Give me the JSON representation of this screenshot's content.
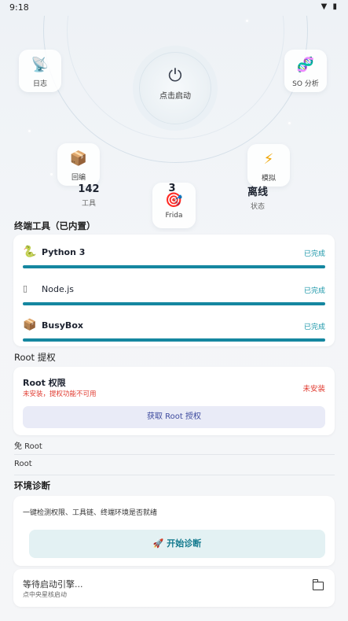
{
  "status_bar": {
    "time": "9:18",
    "icons": "▼ ▮"
  },
  "hero": {
    "power_label": "点击启动",
    "tiles": [
      {
        "icon": "📡",
        "label": "日志"
      },
      {
        "icon": "🧬",
        "label": "SO 分析"
      },
      {
        "icon": "📦",
        "label": "回编"
      },
      {
        "icon": "⚡",
        "label": "模拟"
      },
      {
        "icon": "🎯",
        "label": "Frida"
      }
    ],
    "stats": [
      {
        "value": "142",
        "key": "工具"
      },
      {
        "value": "3",
        "key": ""
      },
      {
        "value": "离线",
        "key": "状态"
      }
    ]
  },
  "terminal": {
    "title": "终端工具（已内置）",
    "tools": [
      {
        "icon": "🐍",
        "name": "Python 3",
        "status": "已完成",
        "progress": 1.0
      },
      {
        "icon": "▯",
        "name": "Node.js",
        "status": "已完成",
        "progress": 1.0
      },
      {
        "icon": "📦",
        "name": "BusyBox",
        "status": "已完成",
        "progress": 1.0
      }
    ]
  },
  "root": {
    "title": "Root 提权",
    "name": "Root 权限",
    "sub": "未安装，提权功能不可用",
    "status": "未安装",
    "button": "获取 Root 授权"
  },
  "no_root": {
    "label": "免 Root"
  },
  "root_plain": {
    "label": "Root"
  },
  "diagnose": {
    "title": "环境诊断",
    "desc": "一键检测权限、工具链、终端环境是否就绪",
    "button": "🚀 开始诊断"
  },
  "log": {
    "title": "等待启动引擎...",
    "sub": "点中央星核启动",
    "icon": "folder-icon"
  },
  "colors": {
    "accent": "#1587a0",
    "done": "#1a96a8",
    "error": "#e03a2f",
    "root_button_bg": "#e9ebf7",
    "diag_button_bg": "#e3f1f3"
  }
}
